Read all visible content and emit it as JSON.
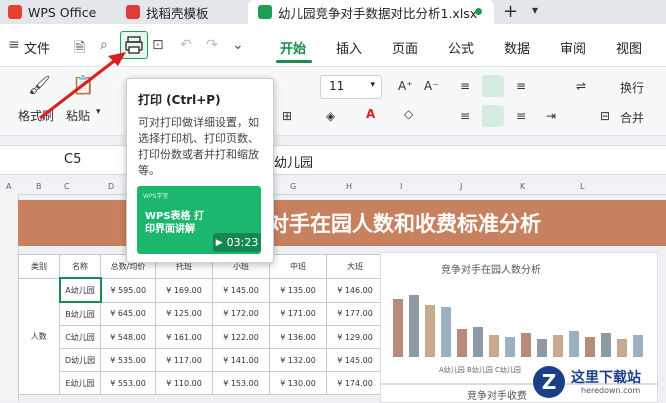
{
  "tabs": {
    "wps": "WPS Office",
    "template": "找稻壳模板",
    "document": "幼儿园竞争对手数据对比分析1.xlsx",
    "new_tab": "+"
  },
  "menu": {
    "file": "文件",
    "start": "开始",
    "insert": "插入",
    "page": "页面",
    "formula": "公式",
    "data": "数据",
    "review": "审阅",
    "view": "视图"
  },
  "ribbon": {
    "format_painter": "格式刷",
    "paste": "粘贴",
    "font_size": "11",
    "wrap": "换行",
    "merge": "合并"
  },
  "formula_bar": {
    "cell_ref": "C5",
    "value": "幼儿园"
  },
  "sheet": {
    "columns": [
      "A",
      "B",
      "C",
      "D",
      "E",
      "F",
      "G",
      "H",
      "I",
      "J",
      "K",
      "L"
    ],
    "title": "对手在园人数和收费标准分析",
    "headers": [
      "类别",
      "名称",
      "总数/均价",
      "托班",
      "小班",
      "中班",
      "大班"
    ],
    "category": "人数",
    "rows": [
      [
        "A幼儿园",
        "¥ 595.00",
        "¥ 169.00",
        "¥ 145.00",
        "¥ 135.00",
        "¥ 146.00"
      ],
      [
        "B幼儿园",
        "¥ 645.00",
        "¥ 125.00",
        "¥ 172.00",
        "¥ 171.00",
        "¥ 177.00"
      ],
      [
        "C幼儿园",
        "¥ 548.00",
        "¥ 161.00",
        "¥ 122.00",
        "¥ 136.00",
        "¥ 129.00"
      ],
      [
        "D幼儿园",
        "¥ 535.00",
        "¥ 117.00",
        "¥ 141.00",
        "¥ 132.00",
        "¥ 145.00"
      ],
      [
        "E幼儿园",
        "¥ 553.00",
        "¥ 110.00",
        "¥ 153.00",
        "¥ 130.00",
        "¥ 174.00"
      ]
    ],
    "chart1_title": "竞争对手在园人数分析",
    "chart1_legend": "A幼儿园  B幼儿园  C幼儿园",
    "chart2_title": "竞争对手收费"
  },
  "tooltip": {
    "title": "打印 (Ctrl+P)",
    "description": "可对打印做详细设置，如选择打印机、打印页数、打印份数或者并打和缩放等。",
    "video_brand": "WPS学堂",
    "video_title": "WPS表格 打印界面讲解",
    "video_duration": "03:23"
  },
  "watermark": {
    "text": "这里下载站",
    "url": "heredown.com"
  },
  "colors": {
    "accent": "#1a8a52",
    "title_band": "#c8815f",
    "video_bg": "#1db66e",
    "arrow": "#d8201f"
  }
}
